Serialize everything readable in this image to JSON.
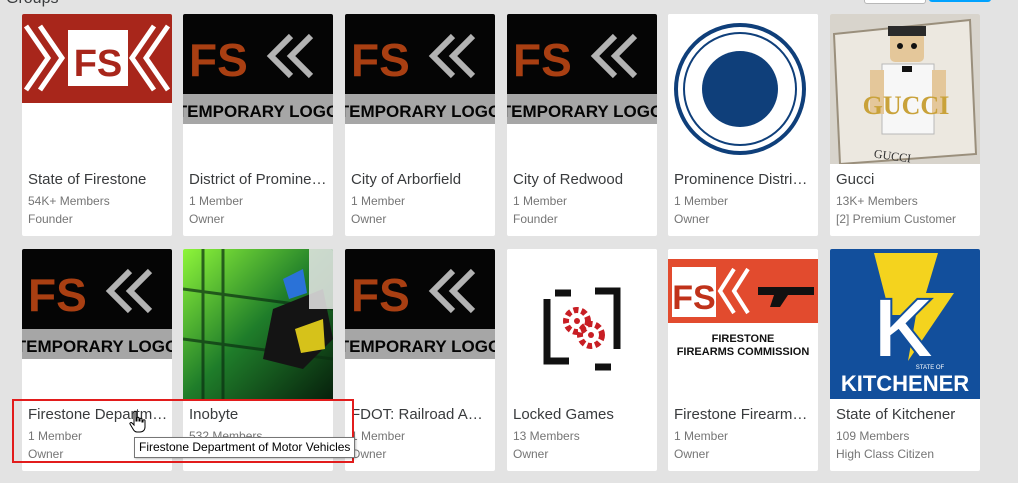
{
  "page": {
    "heading": "Groups"
  },
  "groups": [
    {
      "name": "State of Firestone",
      "members": "54K+ Members",
      "role": "Founder",
      "logo": "fs-red-chevron-logo"
    },
    {
      "name": "District of Prominence",
      "members": "1 Member",
      "role": "Owner",
      "logo": "fs-temporary-logo"
    },
    {
      "name": "City of Arborfield",
      "members": "1 Member",
      "role": "Owner",
      "logo": "fs-temporary-logo"
    },
    {
      "name": "City of Redwood",
      "members": "1 Member",
      "role": "Founder",
      "logo": "fs-temporary-logo"
    },
    {
      "name": "Prominence District Court",
      "members": "1 Member",
      "role": "Owner",
      "logo": "navy-seal-logo"
    },
    {
      "name": "Gucci",
      "members": "13K+ Members",
      "role": "[2] Premium Customer",
      "logo": "gucci-avatar-image"
    },
    {
      "name": "Firestone Department of Motor Vehicles",
      "members": "1 Member",
      "role": "Owner",
      "logo": "fs-temporary-logo"
    },
    {
      "name": "Inobyte",
      "members": "532 Members",
      "role": "Owner",
      "logo": "inobyte-green-scene-image"
    },
    {
      "name": "FDOT: Railroad Administration",
      "members": "1 Member",
      "role": "Owner",
      "logo": "fs-temporary-logo"
    },
    {
      "name": "Locked Games",
      "members": "13 Members",
      "role": "Owner",
      "logo": "locked-games-gear-logo"
    },
    {
      "name": "Firestone Firearms Commission",
      "members": "1 Member",
      "role": "Owner",
      "logo": "fs-firearms-logo"
    },
    {
      "name": "State of Kitchener",
      "members": "109 Members",
      "role": "High Class Citizen",
      "logo": "kitchener-k-logo"
    }
  ],
  "logo_text": {
    "fs": "FS",
    "temporary": "TEMPORARY LOGO",
    "firearms_line1": "FIRESTONE",
    "firearms_line2": "FIREARMS COMMISSION",
    "gucci": "GUCCI",
    "kitchener_state_of": "STATE OF",
    "kitchener": "KITCHENER",
    "k": "K"
  },
  "tooltip": {
    "text": "Firestone Department of Motor Vehicles"
  },
  "colors": {
    "fs_red": "#b5321c",
    "fs_orange": "#a93f12",
    "navy": "#0f3f7a",
    "kitchener_blue": "#124f9c",
    "kitchener_yellow": "#f4d31e",
    "highlight": "#e21c1c"
  }
}
